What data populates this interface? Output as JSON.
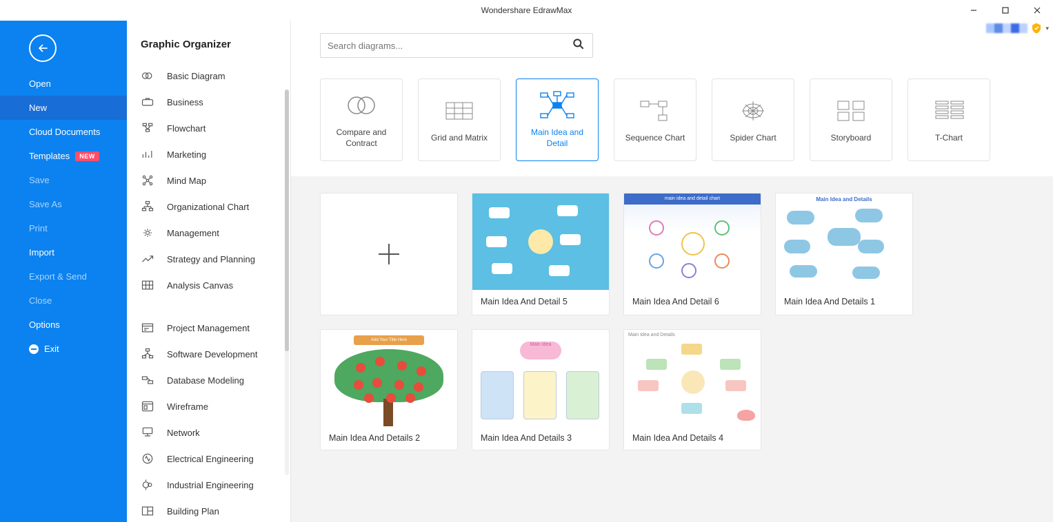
{
  "app": {
    "title": "Wondershare EdrawMax"
  },
  "sidebar_left": {
    "items": [
      {
        "label": "Open",
        "dim": false
      },
      {
        "label": "New",
        "dim": false,
        "active": true
      },
      {
        "label": "Cloud Documents",
        "dim": false
      },
      {
        "label": "Templates",
        "dim": false,
        "badge": "NEW"
      },
      {
        "label": "Save",
        "dim": true
      },
      {
        "label": "Save As",
        "dim": true
      },
      {
        "label": "Print",
        "dim": true
      },
      {
        "label": "Import",
        "dim": false
      },
      {
        "label": "Export & Send",
        "dim": true
      },
      {
        "label": "Close",
        "dim": true
      },
      {
        "label": "Options",
        "dim": false
      },
      {
        "label": "Exit",
        "dim": false,
        "icon": "exit"
      }
    ]
  },
  "categories": {
    "header": "Graphic Organizer",
    "group1": [
      "Basic Diagram",
      "Business",
      "Flowchart",
      "Marketing",
      "Mind Map",
      "Organizational Chart",
      "Management",
      "Strategy and Planning",
      "Analysis Canvas"
    ],
    "group2": [
      "Project Management",
      "Software Development",
      "Database Modeling",
      "Wireframe",
      "Network",
      "Electrical Engineering",
      "Industrial Engineering",
      "Building Plan"
    ]
  },
  "search": {
    "placeholder": "Search diagrams..."
  },
  "types": [
    {
      "label": "Compare and Contract",
      "key": "compare"
    },
    {
      "label": "Grid and Matrix",
      "key": "grid"
    },
    {
      "label": "Main Idea and Detail",
      "key": "mainidea",
      "selected": true
    },
    {
      "label": "Sequence Chart",
      "key": "sequence"
    },
    {
      "label": "Spider Chart",
      "key": "spider"
    },
    {
      "label": "Storyboard",
      "key": "storyboard"
    },
    {
      "label": "T-Chart",
      "key": "tchart"
    }
  ],
  "templates": [
    {
      "caption": "Main Idea And Detail 5",
      "thumb": "thumb-1"
    },
    {
      "caption": "Main Idea And Detail 6",
      "thumb": "thumb-2"
    },
    {
      "caption": "Main Idea And Details 1",
      "thumb": "thumb-3"
    },
    {
      "caption": "Main Idea And Details 2",
      "thumb": "thumb-4"
    },
    {
      "caption": "Main Idea And Details 3",
      "thumb": "thumb-5"
    },
    {
      "caption": "Main Idea And Details 4",
      "thumb": "thumb-6"
    }
  ]
}
